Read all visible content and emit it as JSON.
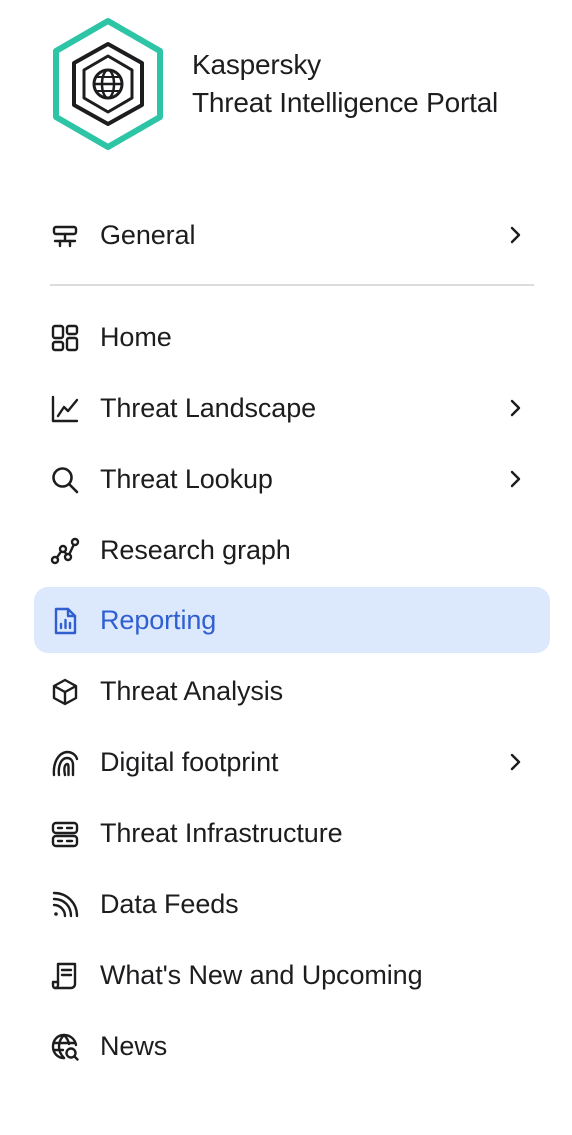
{
  "brand": {
    "name_line1": "Kaspersky",
    "name_line2": "Threat Intelligence Portal",
    "logo_icon": "globe-in-hexagon-icon",
    "accent_color": "#2ec4a6"
  },
  "general": {
    "label": "General",
    "icon": "network-settings-icon",
    "has_submenu": true
  },
  "nav": {
    "items": [
      {
        "label": "Home",
        "icon": "dashboard-grid-icon",
        "has_submenu": false
      },
      {
        "label": "Threat Landscape",
        "icon": "line-chart-icon",
        "has_submenu": true
      },
      {
        "label": "Threat Lookup",
        "icon": "search-icon",
        "has_submenu": true
      },
      {
        "label": "Research graph",
        "icon": "graph-nodes-icon",
        "has_submenu": false
      },
      {
        "label": "Reporting",
        "icon": "report-document-icon",
        "has_submenu": false,
        "active": true
      },
      {
        "label": "Threat Analysis",
        "icon": "cube-icon",
        "has_submenu": false
      },
      {
        "label": "Digital footprint",
        "icon": "fingerprint-icon",
        "has_submenu": true
      },
      {
        "label": "Threat Infrastructure",
        "icon": "server-stack-icon",
        "has_submenu": false
      },
      {
        "label": "Data Feeds",
        "icon": "rss-feed-icon",
        "has_submenu": false
      },
      {
        "label": "What's New and Upcoming",
        "icon": "scroll-document-icon",
        "has_submenu": false
      },
      {
        "label": "News",
        "icon": "globe-search-icon",
        "has_submenu": false
      }
    ]
  },
  "colors": {
    "active_background": "#dce8fc",
    "active_text": "#2f5fd0",
    "text": "#1d1d1f"
  }
}
